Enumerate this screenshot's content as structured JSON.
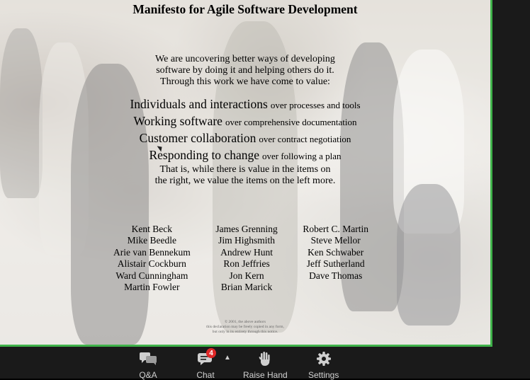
{
  "slide": {
    "title": "Manifesto for Agile Software Development",
    "intro": [
      "We are uncovering better ways of developing",
      "software by doing it and helping others do it.",
      "Through this work we have come to value:"
    ],
    "values": [
      {
        "left": "Individuals and interactions",
        "right": "over processes and tools"
      },
      {
        "left": "Working software",
        "right": "over comprehensive documentation"
      },
      {
        "left": "Customer collaboration",
        "right": "over contract negotiation"
      },
      {
        "left": "Responding to change",
        "right": "over following a plan"
      }
    ],
    "closing": [
      "That is, while there is value in the items on",
      "the right, we value the items on the left more."
    ],
    "signers": [
      [
        "Kent Beck",
        "Mike Beedle",
        "Arie van Bennekum",
        "Alistair Cockburn",
        "Ward Cunningham",
        "Martin Fowler"
      ],
      [
        "James Grenning",
        "Jim Highsmith",
        "Andrew Hunt",
        "Ron Jeffries",
        "Jon Kern",
        "Brian Marick"
      ],
      [
        "Robert C. Martin",
        "Steve Mellor",
        "Ken Schwaber",
        "Jeff Sutherland",
        "Dave Thomas"
      ]
    ],
    "copyright": [
      "© 2001, the above authors",
      "this declaration may be freely copied in any form,",
      "but only in its entirety through this notice."
    ]
  },
  "toolbar": {
    "qa": {
      "label": "Q&A",
      "icon": "qa-icon"
    },
    "chat": {
      "label": "Chat",
      "icon": "chat-icon",
      "badge": "4"
    },
    "raise_hand": {
      "label": "Raise Hand",
      "icon": "hand-icon"
    },
    "settings": {
      "label": "Settings",
      "icon": "gear-icon"
    }
  },
  "colors": {
    "share_border": "#3fb24a",
    "toolbar_bg": "#1a1a1a",
    "badge": "#e02828"
  }
}
